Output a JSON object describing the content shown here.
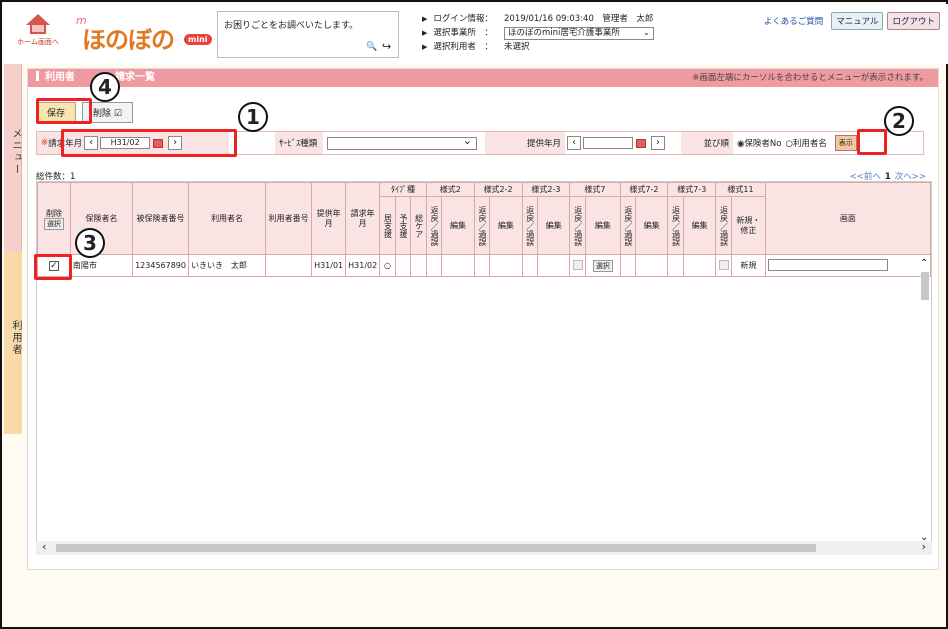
{
  "header": {
    "home_label": "ホーム画面へ",
    "logo_m": "m",
    "logo_main": "ほのぼの",
    "logo_mini": "mini",
    "search_text": "お困りごとをお調べいたします。",
    "login_label": "ログイン情報：",
    "login_value": "2019/01/16 09:03:40　管理者　太郎",
    "office_label": "選択事業所　：",
    "office_value": "ほのぼのmini居宅介護事業所",
    "user_label": "選択利用者　：",
    "user_value": "未選択",
    "faq": "よくあるご質問",
    "manual": "マニュアル",
    "logout": "ログアウト"
  },
  "side": {
    "menu": "メニュー",
    "user": "利用者"
  },
  "page": {
    "title": "利用者　　　　請求一覧",
    "note": "※画面左端にカーソルを合わせるとメニューが表示されます。",
    "save": "保存",
    "delete": "削除"
  },
  "filter": {
    "req_mark": "※",
    "billing_label": "請求年月",
    "billing_value": "H31/02",
    "service_label": "ｻｰﾋﾞｽ種類",
    "provide_label": "提供年月",
    "sort_label": "並び順",
    "sort_opt1": "保険者No",
    "sort_opt2": "利用者名",
    "show": "表示"
  },
  "list": {
    "count": "総件数：1",
    "prev": "<<前へ",
    "page": "1",
    "next": "次へ>>",
    "headers": {
      "del": "削除",
      "select": "選択",
      "insurer": "保険者名",
      "insured_no": "被保険者番号",
      "user_name": "利用者名",
      "user_no": "利用者番号",
      "provide": "提供年月",
      "billing": "請求年月",
      "type": "ﾀｲﾌﾟ種",
      "kyo": "居支援",
      "yo": "予支援",
      "sou": "総ケア",
      "f2": "様式2",
      "f22": "様式2-2",
      "f23": "様式2-3",
      "f7": "様式7",
      "f72": "様式7-2",
      "f73": "様式7-3",
      "f11": "様式11",
      "henrei": "返戻／過誤",
      "edit": "編集",
      "newfix": "新規・修正",
      "screen": "画面"
    },
    "row": {
      "insurer": "南陽市",
      "insured_no": "1234567890",
      "user_name": "いきいき　太郎",
      "user_no": "",
      "provide": "H31/01",
      "billing": "H31/02",
      "kyo": "○",
      "select": "選択",
      "newfix": "新規"
    }
  },
  "callouts": [
    "1",
    "2",
    "3",
    "4"
  ]
}
